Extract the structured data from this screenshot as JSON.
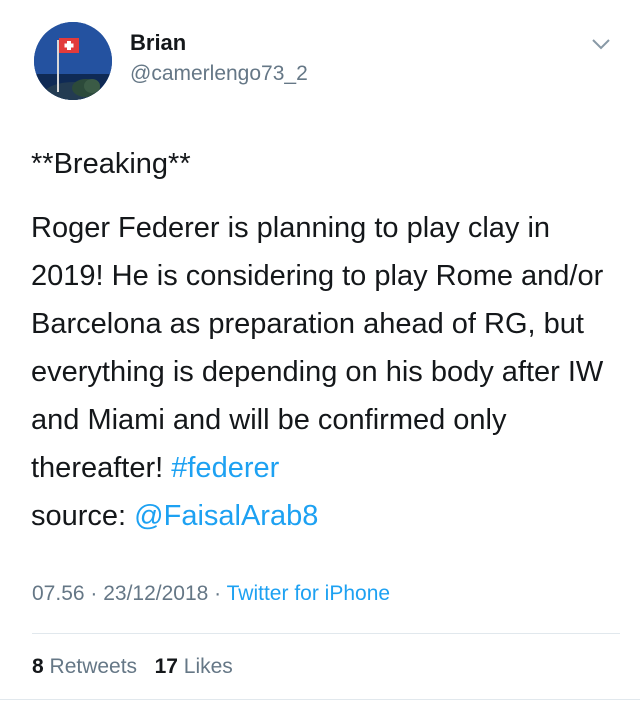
{
  "user": {
    "name": "Brian",
    "handle": "@camerlengo73_2"
  },
  "tweet": {
    "headline": "**Breaking**",
    "text_main": "Roger Federer is planning to play clay in 2019! He is considering to play Rome and/or Barcelona as preparation ahead of RG, but everything is depending on his body after IW and Miami and will be confirmed only thereafter! ",
    "hashtag": "#federer",
    "source_prefix": "source: ",
    "mention": "@FaisalArab8"
  },
  "meta": {
    "time": "07.56",
    "separator": " · ",
    "date": "23/12/2018",
    "client": "Twitter for iPhone"
  },
  "stats": {
    "retweets_count": "8",
    "retweets_label": " Retweets",
    "likes_count": "17",
    "likes_label": " Likes"
  },
  "icons": {
    "avatar": "avatar-image-flag-icon",
    "menu": "chevron-down-icon"
  },
  "colors": {
    "link": "#1da1f2",
    "secondary_text": "#657786",
    "primary_text": "#14171a",
    "divider": "#e1e8ed"
  }
}
